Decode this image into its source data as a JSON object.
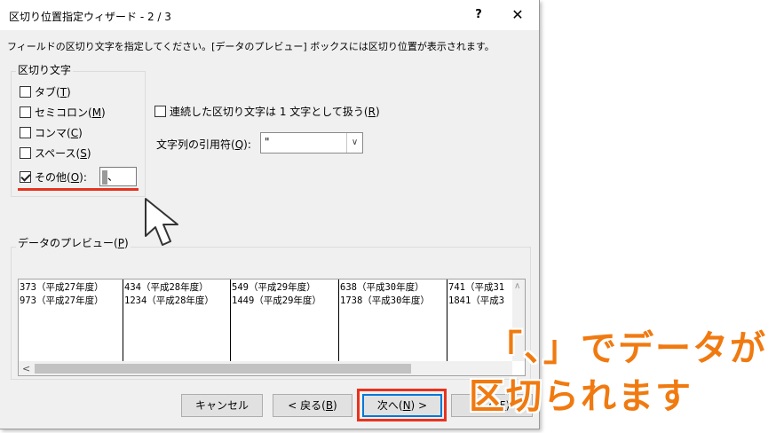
{
  "dialog": {
    "title": "区切り位置指定ウィザード - 2 / 3",
    "help_label": "?",
    "close_label": "✕",
    "instruction": "フィールドの区切り文字を指定してください。[データのプレビュー] ボックスには区切り位置が表示されます。"
  },
  "delimiters": {
    "group_label": "区切り文字",
    "items": [
      {
        "label_pre": "タブ(",
        "key": "T",
        "label_post": ")",
        "checked": false
      },
      {
        "label_pre": "セミコロン(",
        "key": "M",
        "label_post": ")",
        "checked": false
      },
      {
        "label_pre": "コンマ(",
        "key": "C",
        "label_post": ")",
        "checked": false
      },
      {
        "label_pre": "スペース(",
        "key": "S",
        "label_post": ")",
        "checked": false
      },
      {
        "label_pre": "その他(",
        "key": "O",
        "label_post": "):",
        "checked": true
      }
    ],
    "other_value": "、"
  },
  "options": {
    "consecutive_pre": "連続した区切り文字は 1 文字として扱う(",
    "consecutive_key": "R",
    "consecutive_post": ")",
    "consecutive_checked": false,
    "qualifier_label_pre": "文字列の引用符(",
    "qualifier_key": "Q",
    "qualifier_label_post": "):",
    "qualifier_value": "\""
  },
  "preview": {
    "group_label_pre": "データのプレビュー(",
    "group_key": "P",
    "group_label_post": ")",
    "columns": [
      [
        "373（平成27年度）",
        "973（平成27年度）"
      ],
      [
        "434（平成28年度）",
        "1234（平成28年度）"
      ],
      [
        "549（平成29年度）",
        "1449（平成29年度）"
      ],
      [
        "638（平成30年度）",
        "1738（平成30年度）"
      ],
      [
        "741（平成31",
        "1841（平成3"
      ]
    ]
  },
  "buttons": {
    "cancel": "キャンセル",
    "back_pre": "< 戻る(",
    "back_key": "B",
    "back_post": ")",
    "next_pre": "次へ(",
    "next_key": "N",
    "next_post": ") >",
    "finish_pre": "完了(",
    "finish_key": "F",
    "finish_post": ")"
  },
  "annotation": {
    "line1": "「、」でデータが",
    "line2": "区切られます",
    "color": "#f07a10"
  },
  "highlight_color": "#e8321e"
}
